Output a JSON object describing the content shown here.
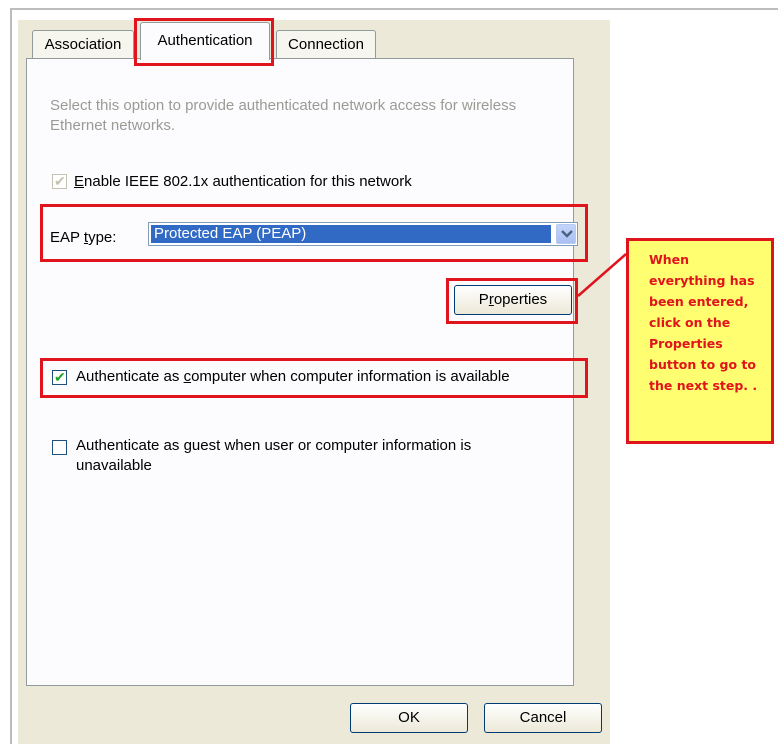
{
  "tabs": [
    {
      "label": "Association"
    },
    {
      "label": "Authentication"
    },
    {
      "label": "Connection"
    }
  ],
  "description": "Select this option to provide authenticated network access for wireless Ethernet networks.",
  "enable_8021x": {
    "pre": "",
    "accel": "E",
    "post": "nable IEEE 802.1x authentication for this network",
    "checked": true,
    "disabled": true
  },
  "eap": {
    "label_pre": "EAP ",
    "label_accel": "t",
    "label_post": "ype:",
    "selected": "Protected EAP (PEAP)"
  },
  "properties_button": {
    "pre": "P",
    "accel": "r",
    "post": "operties"
  },
  "auth_computer": {
    "pre": "Authenticate as ",
    "accel": "c",
    "post": "omputer when computer information is available",
    "checked": true
  },
  "auth_guest": {
    "line1_pre": "Authenticate as ",
    "line1_accel": "g",
    "line1_post": "uest when user or computer information is",
    "line2": "unavailable",
    "checked": false
  },
  "ok_label": "OK",
  "cancel_label": "Cancel",
  "callout": {
    "text": "When everything has been entered, click on the Properties button to go to the next step. ."
  },
  "colors": {
    "highlight": "#e0141c",
    "callout_bg": "#fffd70",
    "selection": "#316ac5"
  }
}
